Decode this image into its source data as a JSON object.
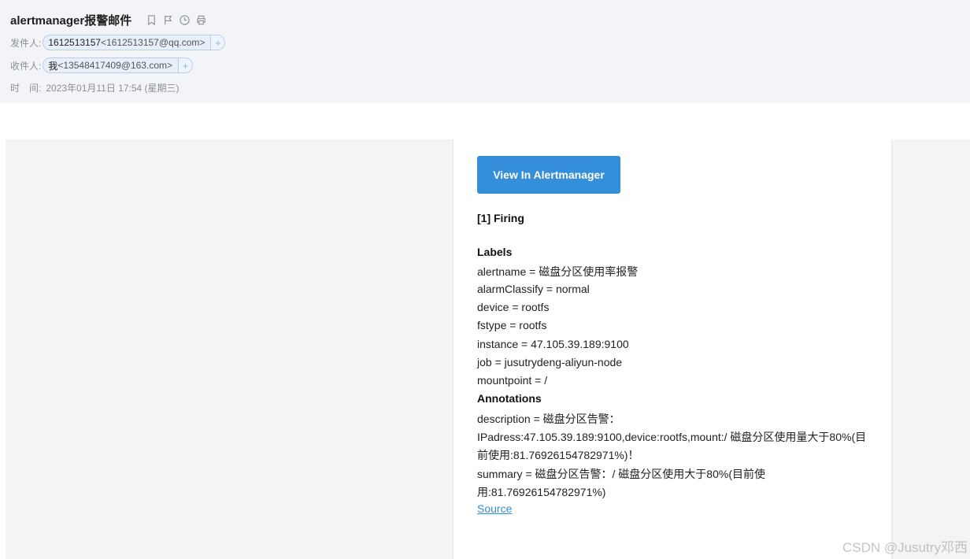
{
  "header": {
    "subject": "alertmanager报警邮件",
    "icons": [
      "bookmark-icon",
      "flag-icon",
      "clock-icon",
      "print-icon"
    ],
    "from_label": "发件人:",
    "from_name": "1612513157",
    "from_addr": "<1612513157@qq.com>",
    "to_label": "收件人:",
    "to_name": "我",
    "to_addr": "<13548417409@163.com>",
    "time_label": "时　间:",
    "time_value": "2023年01月11日 17:54 (星期三)",
    "add_symbol": "+"
  },
  "mail": {
    "button_label": "View In Alertmanager",
    "firing": "[1] Firing",
    "labels_heading": "Labels",
    "labels": [
      "alertname = 磁盘分区使用率报警",
      "alarmClassify = normal",
      "device = rootfs",
      "fstype = rootfs",
      "instance = 47.105.39.189:9100",
      "job = jusutrydeng-aliyun-node",
      "mountpoint = /"
    ],
    "annotations_heading": "Annotations",
    "annotations": [
      "description = 磁盘分区告警：",
      "IPadress:47.105.39.189:9100,device:rootfs,mount:/ 磁盘分区使用量大于80%(目",
      "前使用:81.76926154782971%)！",
      "summary = 磁盘分区告警：/ 磁盘分区使用大于80%(目前使",
      "用:81.76926154782971%)"
    ],
    "source_link": "Source"
  },
  "watermark": "CSDN @Jusutry邓西"
}
